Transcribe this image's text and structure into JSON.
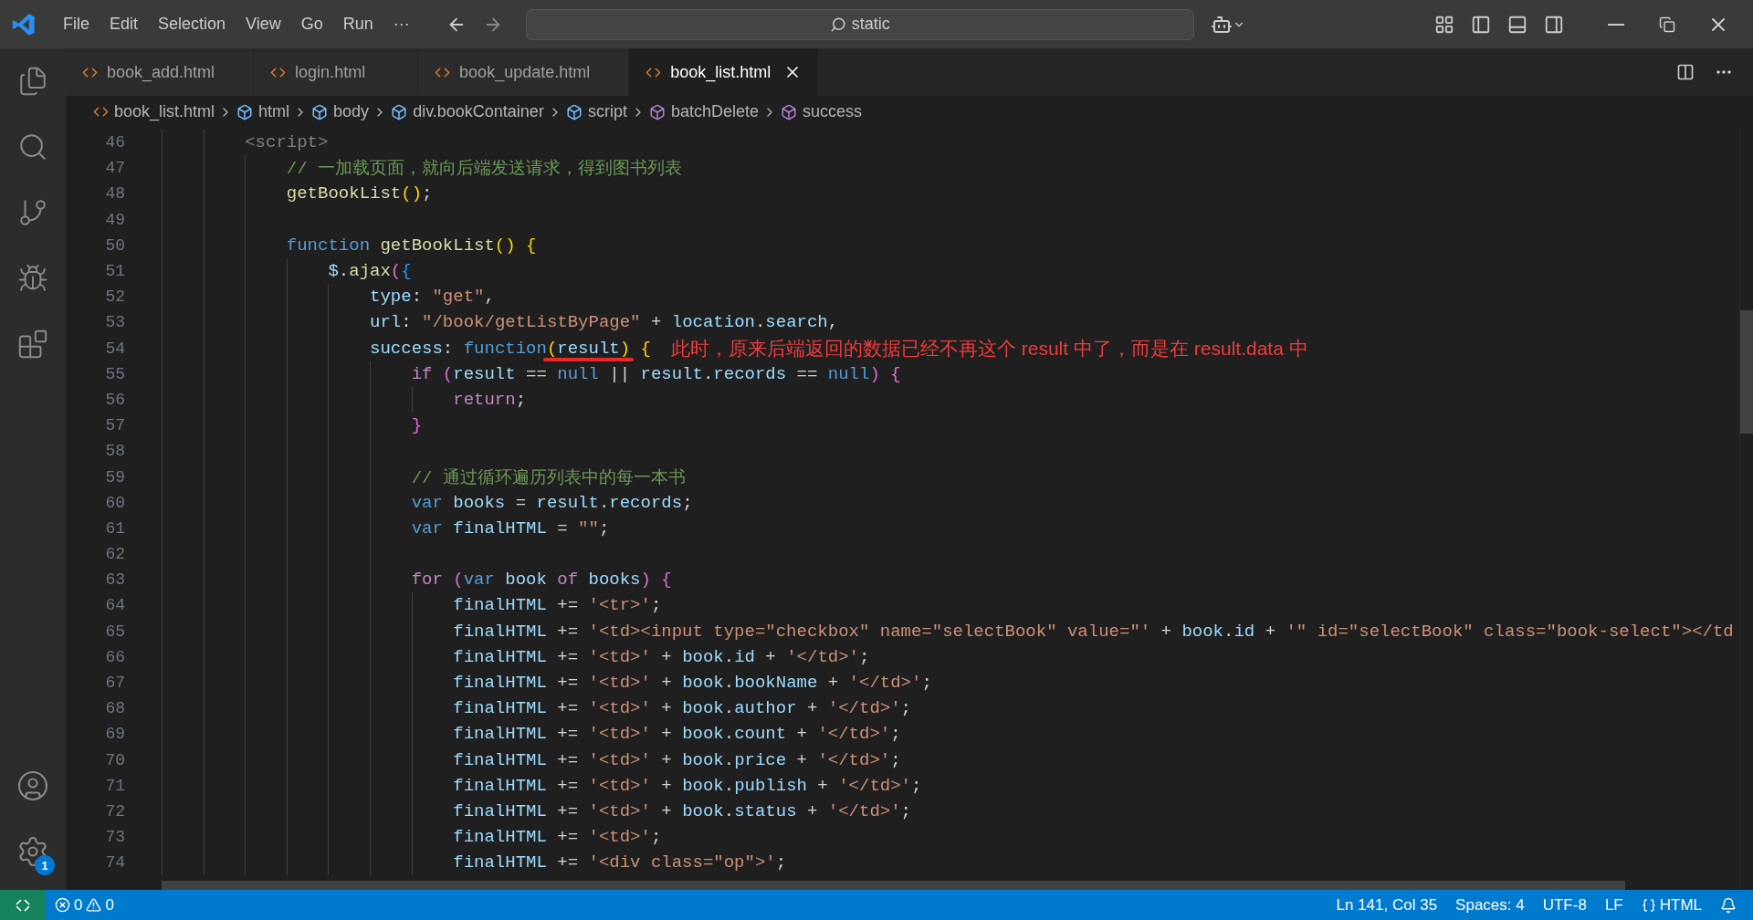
{
  "title_bar": {
    "menu": [
      "File",
      "Edit",
      "Selection",
      "View",
      "Go",
      "Run"
    ],
    "more": "···",
    "search": {
      "value": "static"
    }
  },
  "activity_bar": {
    "items": [
      {
        "kind": "files"
      },
      {
        "kind": "search"
      },
      {
        "kind": "source"
      },
      {
        "kind": "debug"
      },
      {
        "kind": "extensions"
      }
    ],
    "bottom": [
      {
        "kind": "account"
      },
      {
        "kind": "settings",
        "badge": "1"
      }
    ]
  },
  "tabs": [
    {
      "label": "book_add.html",
      "selected": false
    },
    {
      "label": "login.html",
      "selected": false
    },
    {
      "label": "book_update.html",
      "selected": false
    },
    {
      "label": "book_list.html",
      "selected": true
    }
  ],
  "breadcrumb": [
    {
      "label": "book_list.html",
      "kind": "file"
    },
    {
      "label": "html",
      "kind": "element"
    },
    {
      "label": "body",
      "kind": "element"
    },
    {
      "label": "div.bookContainer",
      "kind": "element"
    },
    {
      "label": "script",
      "kind": "element"
    },
    {
      "label": "batchDelete",
      "kind": "method"
    },
    {
      "label": "success",
      "kind": "method"
    }
  ],
  "editor": {
    "lines": [
      {
        "number": "46",
        "tokens": [
          {
            "kind": "tag",
            "text": "<script>"
          }
        ],
        "children": [
          {
            "number": "47",
            "tokens": [
              {
                "kind": "comment",
                "text": "// 一加载页面，就向后端发送请求，得到图书列表"
              }
            ]
          },
          {
            "number": "48",
            "tokens": [
              {
                "kind": "function",
                "text": "getBookList"
              },
              {
                "kind": "bracket1",
                "text": "()"
              },
              {
                "kind": "plain",
                "text": ";"
              }
            ]
          },
          {
            "number": "49"
          },
          {
            "number": "50",
            "tokens": [
              {
                "kind": "keyword",
                "text": "function "
              },
              {
                "kind": "function",
                "text": "getBookList"
              },
              {
                "kind": "bracket1",
                "text": "() {"
              }
            ],
            "children": [
              {
                "number": "51",
                "tokens": [
                  {
                    "kind": "variable",
                    "text": "$"
                  },
                  {
                    "kind": "plain",
                    "text": "."
                  },
                  {
                    "kind": "function",
                    "text": "ajax"
                  },
                  {
                    "kind": "bracket2",
                    "text": "("
                  },
                  {
                    "kind": "bracket3",
                    "text": "{"
                  }
                ],
                "children": [
                  {
                    "number": "52",
                    "tokens": [
                      {
                        "kind": "variable",
                        "text": "type"
                      },
                      {
                        "kind": "plain",
                        "text": ": "
                      },
                      {
                        "kind": "string",
                        "text": "\"get\""
                      },
                      {
                        "kind": "plain",
                        "text": ","
                      }
                    ]
                  },
                  {
                    "number": "53",
                    "tokens": [
                      {
                        "kind": "variable",
                        "text": "url"
                      },
                      {
                        "kind": "plain",
                        "text": ": "
                      },
                      {
                        "kind": "string",
                        "text": "\"/book/getListByPage\""
                      },
                      {
                        "kind": "plain",
                        "text": " + "
                      },
                      {
                        "kind": "variable",
                        "text": "location"
                      },
                      {
                        "kind": "plain",
                        "text": "."
                      },
                      {
                        "kind": "variable",
                        "text": "search"
                      },
                      {
                        "kind": "plain",
                        "text": ","
                      }
                    ]
                  },
                  {
                    "number": "54",
                    "tokens": [
                      {
                        "kind": "variable",
                        "text": "success"
                      },
                      {
                        "kind": "plain",
                        "text": ": "
                      },
                      {
                        "kind": "keyword",
                        "text": "function"
                      },
                      {
                        "kind": "bracket1",
                        "text": "(",
                        "underlined": true
                      },
                      {
                        "kind": "variable",
                        "text": "result",
                        "underlined": true
                      },
                      {
                        "kind": "bracket1",
                        "text": ")",
                        "underlined": true
                      },
                      {
                        "kind": "bracket1",
                        "text": " {"
                      }
                    ],
                    "annotation": "此时，原来后端返回的数据已经不再这个 result 中了，而是在 result.data 中",
                    "children": [
                      {
                        "number": "55",
                        "tokens": [
                          {
                            "kind": "control",
                            "text": "if "
                          },
                          {
                            "kind": "bracket2",
                            "text": "("
                          },
                          {
                            "kind": "variable",
                            "text": "result"
                          },
                          {
                            "kind": "plain",
                            "text": " == "
                          },
                          {
                            "kind": "keyword",
                            "text": "null"
                          },
                          {
                            "kind": "plain",
                            "text": " || "
                          },
                          {
                            "kind": "variable",
                            "text": "result"
                          },
                          {
                            "kind": "plain",
                            "text": "."
                          },
                          {
                            "kind": "variable",
                            "text": "records"
                          },
                          {
                            "kind": "plain",
                            "text": " == "
                          },
                          {
                            "kind": "keyword",
                            "text": "null"
                          },
                          {
                            "kind": "bracket2",
                            "text": ") {"
                          }
                        ],
                        "children": [
                          {
                            "number": "56",
                            "tokens": [
                              {
                                "kind": "control",
                                "text": "return"
                              },
                              {
                                "kind": "plain",
                                "text": ";"
                              }
                            ]
                          }
                        ]
                      },
                      {
                        "number": "57",
                        "tokens": [
                          {
                            "kind": "bracket2",
                            "text": "}"
                          }
                        ]
                      },
                      {
                        "number": "58"
                      },
                      {
                        "number": "59",
                        "tokens": [
                          {
                            "kind": "comment",
                            "text": "// 通过循环遍历列表中的每一本书"
                          }
                        ]
                      },
                      {
                        "number": "60",
                        "tokens": [
                          {
                            "kind": "keyword",
                            "text": "var "
                          },
                          {
                            "kind": "variable",
                            "text": "books"
                          },
                          {
                            "kind": "plain",
                            "text": " = "
                          },
                          {
                            "kind": "variable",
                            "text": "result"
                          },
                          {
                            "kind": "plain",
                            "text": "."
                          },
                          {
                            "kind": "variable",
                            "text": "records"
                          },
                          {
                            "kind": "plain",
                            "text": ";"
                          }
                        ]
                      },
                      {
                        "number": "61",
                        "tokens": [
                          {
                            "kind": "keyword",
                            "text": "var "
                          },
                          {
                            "kind": "variable",
                            "text": "finalHTML"
                          },
                          {
                            "kind": "plain",
                            "text": " = "
                          },
                          {
                            "kind": "string",
                            "text": "\"\""
                          },
                          {
                            "kind": "plain",
                            "text": ";"
                          }
                        ]
                      },
                      {
                        "number": "62"
                      },
                      {
                        "number": "63",
                        "tokens": [
                          {
                            "kind": "control",
                            "text": "for "
                          },
                          {
                            "kind": "bracket2",
                            "text": "("
                          },
                          {
                            "kind": "keyword",
                            "text": "var "
                          },
                          {
                            "kind": "variable",
                            "text": "book "
                          },
                          {
                            "kind": "control",
                            "text": "of "
                          },
                          {
                            "kind": "variable",
                            "text": "books"
                          },
                          {
                            "kind": "bracket2",
                            "text": ") {"
                          }
                        ],
                        "children": [
                          {
                            "number": "64",
                            "tokens": [
                              {
                                "kind": "variable",
                                "text": "finalHTML"
                              },
                              {
                                "kind": "plain",
                                "text": " += "
                              },
                              {
                                "kind": "string",
                                "text": "'<tr>'"
                              },
                              {
                                "kind": "plain",
                                "text": ";"
                              }
                            ]
                          },
                          {
                            "number": "65",
                            "tokens": [
                              {
                                "kind": "variable",
                                "text": "finalHTML"
                              },
                              {
                                "kind": "plain",
                                "text": " += "
                              },
                              {
                                "kind": "string",
                                "text": "'<td><input type=\"checkbox\" name=\"selectBook\" value=\"'"
                              },
                              {
                                "kind": "plain",
                                "text": " + "
                              },
                              {
                                "kind": "variable",
                                "text": "book"
                              },
                              {
                                "kind": "plain",
                                "text": "."
                              },
                              {
                                "kind": "variable",
                                "text": "id"
                              },
                              {
                                "kind": "plain",
                                "text": " + "
                              },
                              {
                                "kind": "string",
                                "text": "'\" id=\"selectBook\" class=\"book-select\"></td"
                              }
                            ]
                          },
                          {
                            "number": "66",
                            "tokens": [
                              {
                                "kind": "variable",
                                "text": "finalHTML"
                              },
                              {
                                "kind": "plain",
                                "text": " += "
                              },
                              {
                                "kind": "string",
                                "text": "'<td>'"
                              },
                              {
                                "kind": "plain",
                                "text": " + "
                              },
                              {
                                "kind": "variable",
                                "text": "book"
                              },
                              {
                                "kind": "plain",
                                "text": "."
                              },
                              {
                                "kind": "variable",
                                "text": "id"
                              },
                              {
                                "kind": "plain",
                                "text": " + "
                              },
                              {
                                "kind": "string",
                                "text": "'</td>'"
                              },
                              {
                                "kind": "plain",
                                "text": ";"
                              }
                            ]
                          },
                          {
                            "number": "67",
                            "tokens": [
                              {
                                "kind": "variable",
                                "text": "finalHTML"
                              },
                              {
                                "kind": "plain",
                                "text": " += "
                              },
                              {
                                "kind": "string",
                                "text": "'<td>'"
                              },
                              {
                                "kind": "plain",
                                "text": " + "
                              },
                              {
                                "kind": "variable",
                                "text": "book"
                              },
                              {
                                "kind": "plain",
                                "text": "."
                              },
                              {
                                "kind": "variable",
                                "text": "bookName"
                              },
                              {
                                "kind": "plain",
                                "text": " + "
                              },
                              {
                                "kind": "string",
                                "text": "'</td>'"
                              },
                              {
                                "kind": "plain",
                                "text": ";"
                              }
                            ]
                          },
                          {
                            "number": "68",
                            "tokens": [
                              {
                                "kind": "variable",
                                "text": "finalHTML"
                              },
                              {
                                "kind": "plain",
                                "text": " += "
                              },
                              {
                                "kind": "string",
                                "text": "'<td>'"
                              },
                              {
                                "kind": "plain",
                                "text": " + "
                              },
                              {
                                "kind": "variable",
                                "text": "book"
                              },
                              {
                                "kind": "plain",
                                "text": "."
                              },
                              {
                                "kind": "variable",
                                "text": "author"
                              },
                              {
                                "kind": "plain",
                                "text": " + "
                              },
                              {
                                "kind": "string",
                                "text": "'</td>'"
                              },
                              {
                                "kind": "plain",
                                "text": ";"
                              }
                            ]
                          },
                          {
                            "number": "69",
                            "tokens": [
                              {
                                "kind": "variable",
                                "text": "finalHTML"
                              },
                              {
                                "kind": "plain",
                                "text": " += "
                              },
                              {
                                "kind": "string",
                                "text": "'<td>'"
                              },
                              {
                                "kind": "plain",
                                "text": " + "
                              },
                              {
                                "kind": "variable",
                                "text": "book"
                              },
                              {
                                "kind": "plain",
                                "text": "."
                              },
                              {
                                "kind": "variable",
                                "text": "count"
                              },
                              {
                                "kind": "plain",
                                "text": " + "
                              },
                              {
                                "kind": "string",
                                "text": "'</td>'"
                              },
                              {
                                "kind": "plain",
                                "text": ";"
                              }
                            ]
                          },
                          {
                            "number": "70",
                            "tokens": [
                              {
                                "kind": "variable",
                                "text": "finalHTML"
                              },
                              {
                                "kind": "plain",
                                "text": " += "
                              },
                              {
                                "kind": "string",
                                "text": "'<td>'"
                              },
                              {
                                "kind": "plain",
                                "text": " + "
                              },
                              {
                                "kind": "variable",
                                "text": "book"
                              },
                              {
                                "kind": "plain",
                                "text": "."
                              },
                              {
                                "kind": "variable",
                                "text": "price"
                              },
                              {
                                "kind": "plain",
                                "text": " + "
                              },
                              {
                                "kind": "string",
                                "text": "'</td>'"
                              },
                              {
                                "kind": "plain",
                                "text": ";"
                              }
                            ]
                          },
                          {
                            "number": "71",
                            "tokens": [
                              {
                                "kind": "variable",
                                "text": "finalHTML"
                              },
                              {
                                "kind": "plain",
                                "text": " += "
                              },
                              {
                                "kind": "string",
                                "text": "'<td>'"
                              },
                              {
                                "kind": "plain",
                                "text": " + "
                              },
                              {
                                "kind": "variable",
                                "text": "book"
                              },
                              {
                                "kind": "plain",
                                "text": "."
                              },
                              {
                                "kind": "variable",
                                "text": "publish"
                              },
                              {
                                "kind": "plain",
                                "text": " + "
                              },
                              {
                                "kind": "string",
                                "text": "'</td>'"
                              },
                              {
                                "kind": "plain",
                                "text": ";"
                              }
                            ]
                          },
                          {
                            "number": "72",
                            "tokens": [
                              {
                                "kind": "variable",
                                "text": "finalHTML"
                              },
                              {
                                "kind": "plain",
                                "text": " += "
                              },
                              {
                                "kind": "string",
                                "text": "'<td>'"
                              },
                              {
                                "kind": "plain",
                                "text": " + "
                              },
                              {
                                "kind": "variable",
                                "text": "book"
                              },
                              {
                                "kind": "plain",
                                "text": "."
                              },
                              {
                                "kind": "variable",
                                "text": "status"
                              },
                              {
                                "kind": "plain",
                                "text": " + "
                              },
                              {
                                "kind": "string",
                                "text": "'</td>'"
                              },
                              {
                                "kind": "plain",
                                "text": ";"
                              }
                            ]
                          },
                          {
                            "number": "73",
                            "tokens": [
                              {
                                "kind": "variable",
                                "text": "finalHTML"
                              },
                              {
                                "kind": "plain",
                                "text": " += "
                              },
                              {
                                "kind": "string",
                                "text": "'<td>'"
                              },
                              {
                                "kind": "plain",
                                "text": ";"
                              }
                            ]
                          },
                          {
                            "number": "74",
                            "tokens": [
                              {
                                "kind": "variable",
                                "text": "finalHTML"
                              },
                              {
                                "kind": "plain",
                                "text": " += "
                              },
                              {
                                "kind": "string",
                                "text": "'<div class=\"op\">'"
                              },
                              {
                                "kind": "plain",
                                "text": ";"
                              }
                            ]
                          }
                        ]
                      }
                    ]
                  }
                ]
              }
            ]
          }
        ]
      }
    ]
  },
  "status_bar": {
    "errors": "0",
    "warnings": "0",
    "position": "Ln 141, Col 35",
    "indentation": "Spaces: 4",
    "encoding": "UTF-8",
    "eol": "LF",
    "language": "HTML"
  }
}
